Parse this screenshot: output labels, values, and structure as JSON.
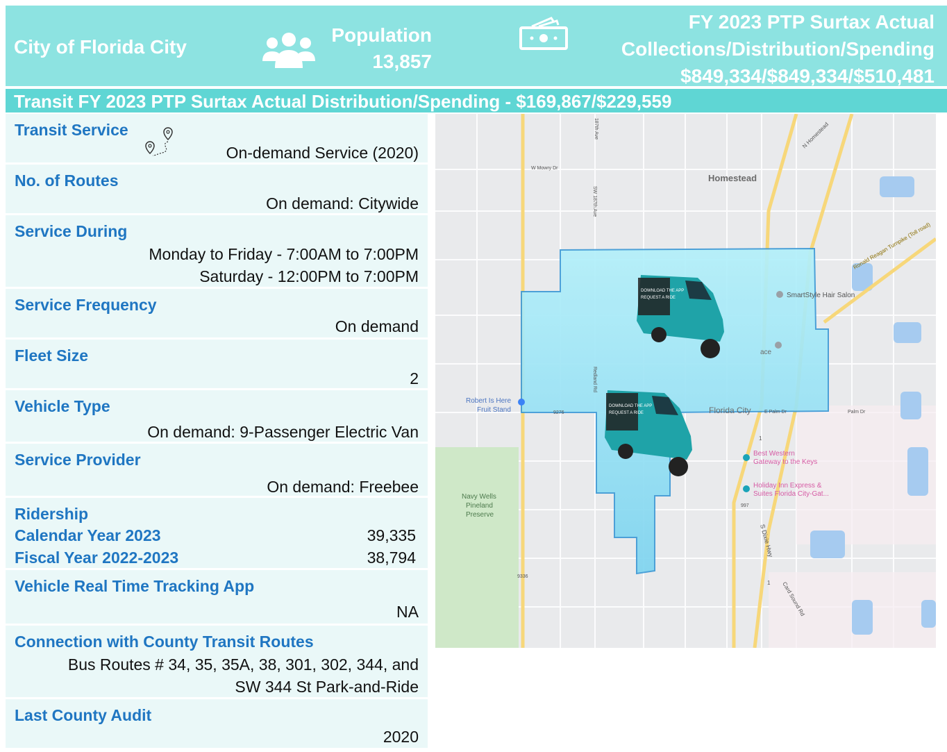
{
  "header": {
    "city": "City of Florida City",
    "population_label": "Population",
    "population_value": "13,857",
    "ptp_line1": "FY 2023 PTP Surtax Actual",
    "ptp_line2": "Collections/Distribution/Spending",
    "ptp_line3": "$849,334/$849,334/$510,481"
  },
  "transit_bar": "Transit FY 2023 PTP Surtax Actual Distribution/Spending - $169,867/$229,559",
  "rows": {
    "transit_service": {
      "title": "Transit Service",
      "value": "On-demand Service (2020)"
    },
    "routes": {
      "title": "No. of Routes",
      "value": "On demand: Citywide"
    },
    "service_during": {
      "title": "Service During",
      "line1": "Monday to Friday - 7:00AM to 7:00PM",
      "line2": "Saturday - 12:00PM to 7:00PM"
    },
    "frequency": {
      "title": "Service Frequency",
      "value": "On demand"
    },
    "fleet": {
      "title": "Fleet Size",
      "value": "2"
    },
    "vehicle": {
      "title": "Vehicle Type",
      "value": "On demand: 9-Passenger Electric Van"
    },
    "provider": {
      "title": "Service Provider",
      "value": "On demand: Freebee"
    },
    "ridership": {
      "title": "Ridership",
      "calendar_label": "Calendar Year 2023",
      "calendar_value": "39,335",
      "fiscal_label": "Fiscal Year 2022-2023",
      "fiscal_value": "38,794"
    },
    "tracking": {
      "title": "Vehicle Real Time Tracking App",
      "value": "NA"
    },
    "connection": {
      "title": "Connection with County Transit Routes",
      "line1": "Bus Routes # 34, 35, 35A, 38, 301, 302, 344, and",
      "line2": "SW 344 St Park-and-Ride"
    },
    "audit": {
      "title": "Last County Audit",
      "value": "2020"
    }
  },
  "map": {
    "labels": {
      "homestead": "Homestead",
      "mowry": "W Mowry Dr",
      "ave187": "187th Ave",
      "sw187": "SW 187th Ave",
      "n_homestead": "N Homestead",
      "turnpike": "Ronald Reagan Turnpike (Toll road)",
      "smartstyle": "SmartStyle Hair Salon",
      "robert1": "Robert Is Here",
      "robert2": "Fruit Stand",
      "florida_city": "Florida City",
      "palm_dr": "E Palm Dr",
      "palm_dr2": "Palm Dr",
      "bw1": "Best Western",
      "bw2": "Gateway to the Keys",
      "hi1": "Holiday Inn Express &",
      "hi2": "Suites Florida City-Gat...",
      "navy1": "Navy Wells",
      "navy2": "Pineland",
      "navy3": "Preserve",
      "dixie": "S Dixie Hwy",
      "card_sound": "Card Sound Rd",
      "redland": "Redland Rd",
      "shield_9336": "9336",
      "shield_997": "997",
      "shield_1": "1",
      "shield_9276": "9276",
      "ace": "ace",
      "van_text1": "DOWNLOAD THE APP",
      "van_text2": "REQUEST A RIDE"
    },
    "colors": {
      "background": "#e9eaec",
      "service_area": "#63d8ec",
      "major_road": "#f7d77a",
      "van_body": "#1fa3a8"
    }
  }
}
